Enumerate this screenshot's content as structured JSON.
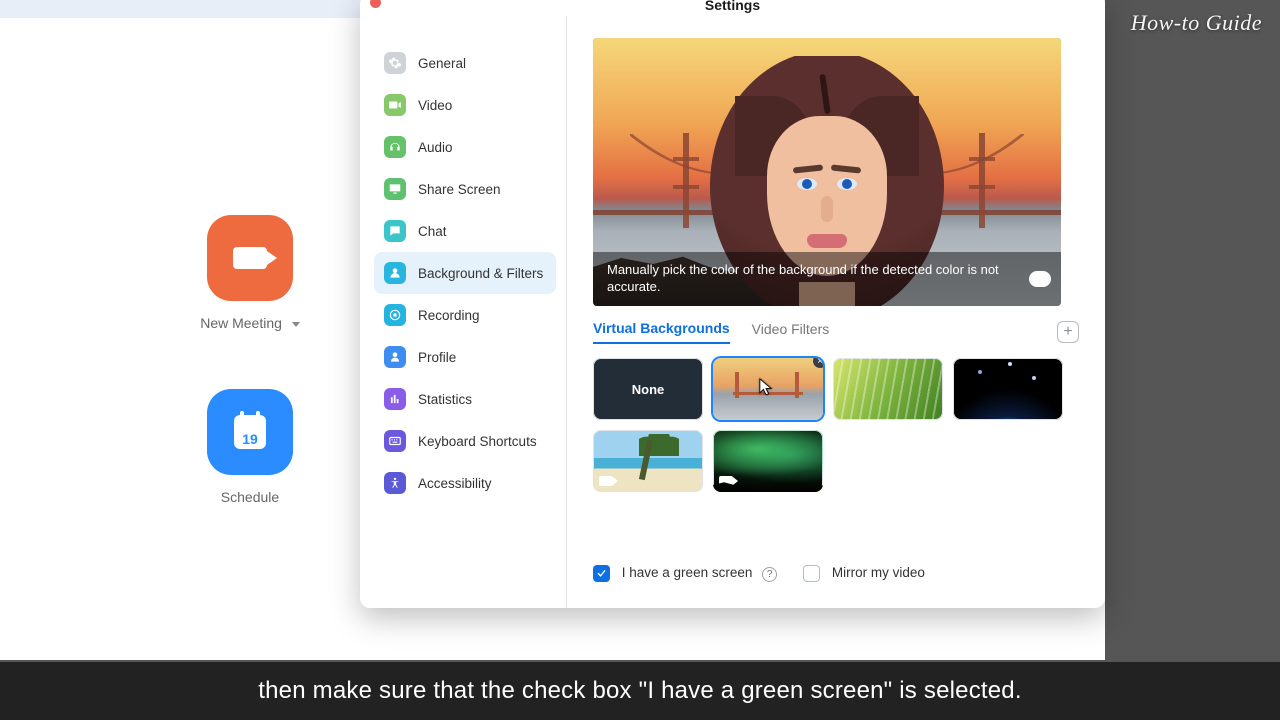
{
  "watermark": "How-to Guide",
  "caption": "then make sure that the check box \"I have a green screen\" is selected.",
  "home": {
    "new_meeting": "New Meeting",
    "schedule": "Schedule",
    "calendar_day": "19"
  },
  "settings": {
    "title": "Settings",
    "sidebar": [
      {
        "label": "General"
      },
      {
        "label": "Video"
      },
      {
        "label": "Audio"
      },
      {
        "label": "Share Screen"
      },
      {
        "label": "Chat"
      },
      {
        "label": "Background & Filters"
      },
      {
        "label": "Recording"
      },
      {
        "label": "Profile"
      },
      {
        "label": "Statistics"
      },
      {
        "label": "Keyboard Shortcuts"
      },
      {
        "label": "Accessibility"
      }
    ],
    "preview_tip": "Manually pick the color of the background if the detected color is not accurate.",
    "tabs": {
      "virtual": "Virtual Backgrounds",
      "filters": "Video Filters"
    },
    "thumb_none": "None",
    "green_screen_label": "I have a green screen",
    "mirror_label": "Mirror my video"
  }
}
